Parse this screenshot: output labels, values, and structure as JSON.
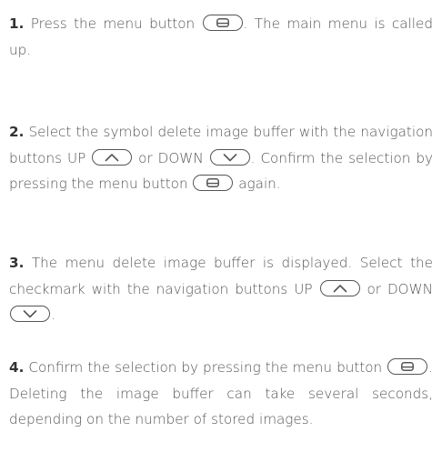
{
  "steps": [
    {
      "number": "1.",
      "text_a": " Press the menu button ",
      "icon_a": "menu-button-icon",
      "text_b": ". The main menu is called up."
    },
    {
      "number": "2.",
      "text_a": " Select the symbol delete image buffer with the navigation buttons UP ",
      "icon_a": "up-button-icon",
      "text_b": " or DOWN ",
      "icon_b": "down-button-icon",
      "text_c": ". Confirm the selection by pressing the menu button ",
      "icon_c": "menu-button-icon",
      "text_d": " again."
    },
    {
      "number": "3.",
      "text_a": " The menu delete image buffer is displayed. Select the checkmark with the navigation buttons UP ",
      "icon_a": "up-button-icon",
      "text_b": " or DOWN ",
      "icon_b": "down-button-icon",
      "text_c": "."
    },
    {
      "number": "4.",
      "text_a": " Confirm the selection by pressing the menu button ",
      "icon_a": "menu-button-icon",
      "text_b": ". Deleting the image buffer can take several seconds, depending on the number of sto­red images."
    }
  ]
}
